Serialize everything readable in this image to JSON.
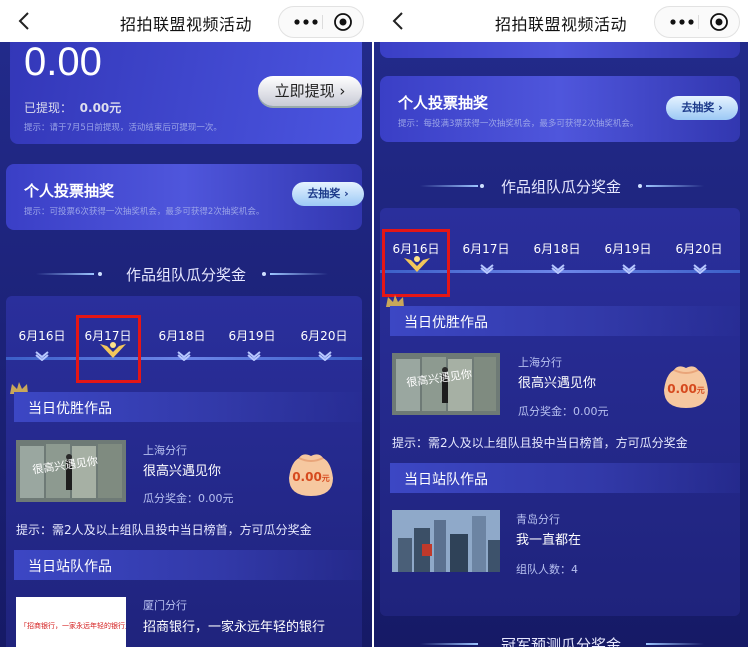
{
  "nav": {
    "title": "招拍联盟视频活动"
  },
  "balance": {
    "amount": "0.00",
    "withdrawn_label": "已提现：",
    "withdrawn_value": "0.00元",
    "hint": "提示：请于7月5日前提现，活动结束后可提现一次。",
    "button": "立即提现"
  },
  "vote_card": {
    "title": "个人投票抽奖",
    "hint_left": "提示：可投票6次获得一次抽奖机会，最多可获得2次抽奖机会。",
    "hint_right": "提示：每投满3票获得一次抽奖机会，最多可获得2次抽奖机会。",
    "button": "去抽奖"
  },
  "section1": {
    "title": "作品组队瓜分奖金"
  },
  "dates": [
    "6月16日",
    "6月17日",
    "6月18日",
    "6月19日",
    "6月20日"
  ],
  "left": {
    "selected_date": "6月17日",
    "daily_best_title": "当日优胜作品",
    "best": {
      "branch": "上海分行",
      "name": "很高兴遇见你",
      "prize": "瓜分奖金：0.00元",
      "bag": "0.00",
      "bag_unit": "元",
      "thumb_text": "很高兴遇见你"
    },
    "tip": "提示：需2人及以上组队且投中当日榜首，方可瓜分奖金",
    "team_title": "当日站队作品",
    "team": {
      "branch": "厦门分行",
      "name": "招商银行，一家永远年轻的银行",
      "thumb_text": "「招商银行，一家永远年轻的银行」"
    }
  },
  "right": {
    "selected_date": "6月16日",
    "daily_best_title": "当日优胜作品",
    "best": {
      "branch": "上海分行",
      "name": "很高兴遇见你",
      "prize": "瓜分奖金：0.00元",
      "bag": "0.00",
      "bag_unit": "元",
      "thumb_text": "很高兴遇见你"
    },
    "tip": "提示：需2人及以上组队且投中当日榜首，方可瓜分奖金",
    "team_title": "当日站队作品",
    "team": {
      "branch": "青岛分行",
      "name": "我一直都在",
      "count": "组队人数：4"
    },
    "section2_title": "冠军预测瓜分奖金"
  },
  "colors": {
    "highlight_box": "#e51616",
    "bg": "#1a1d74",
    "accent": "#f2c65a"
  }
}
